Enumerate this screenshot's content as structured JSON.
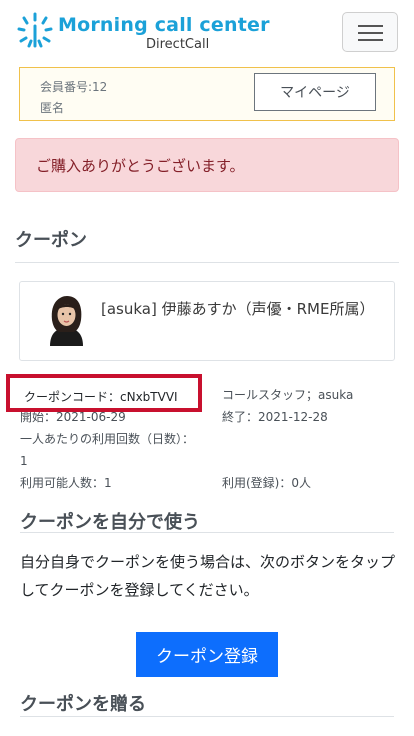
{
  "header": {
    "brand_title": "Morning call center",
    "brand_subtitle": "DirectCall",
    "brand_color": "#1ba1d8",
    "logo_icon": "sunburst-logo-icon",
    "menu_icon": "hamburger-menu-icon"
  },
  "member": {
    "number": "会員番号:12",
    "name": "匿名",
    "mypage_label": "マイページ"
  },
  "alert": {
    "message": "ご購入ありがとうございます。"
  },
  "coupon_section": {
    "title": "クーポン"
  },
  "teacher": {
    "name": "[asuka] 伊藤あすか（声優・RME所属）"
  },
  "coupon_info": {
    "code": "クーポンコード：cNxbTVVI",
    "staff": "コールスタッフ；asuka",
    "start": "開始：2021-06-29",
    "end": "終了：2021-12-28",
    "per_person_uses": "一人あたりの利用回数（日数）：1",
    "users_allowed": "利用可能人数：1",
    "registered_users": "利用(登録)：0人"
  },
  "self_use": {
    "title": "クーポンを自分で使う",
    "description": "自分自身でクーポンを使う場合は、次のボタンをタップしてクーポンを登録してください。",
    "register_label": "クーポン登録"
  },
  "gift": {
    "title": "クーポンを贈る"
  }
}
